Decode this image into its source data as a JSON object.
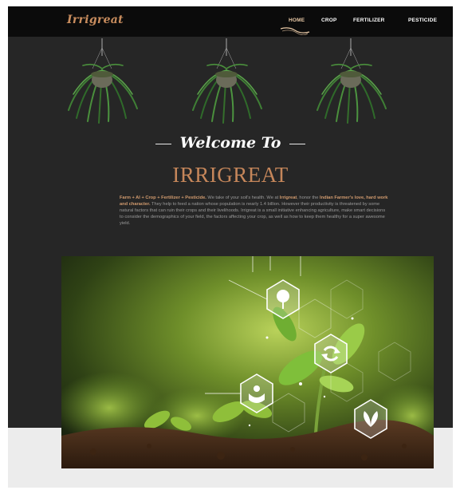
{
  "header": {
    "logo": "Irrigreat",
    "nav": [
      {
        "label": "HOME",
        "active": true
      },
      {
        "label": "CROP",
        "active": false
      },
      {
        "label": "FERTILIZER",
        "active": false
      },
      {
        "label": "PESTICIDE",
        "active": false
      }
    ]
  },
  "hero": {
    "welcome": "Welcome To",
    "brand": "IRRIGREAT"
  },
  "intro": {
    "highlight_1": "Farm + AI + Crop + Fertilizer + Pesticide.",
    "text_1": " We take of your soil's health. We at ",
    "highlight_2": "Irrigreat",
    "text_2": ", honor the ",
    "highlight_3": "Indian Farmer's love, hard work and character.",
    "text_3": " They help to feed a nation whose population is nearly 1.4 billion. However their productivity is threatened by some natural factors that can ruin their crops and their livelihoods. Irrigreat is a small initiative enhancing agriculture, make smart decisions to consider the demographics of your field, the factors affecting your crop, as well as how to keep them healthy for a super awesome yield."
  },
  "icons": {
    "plant_1": "hanging-plant-icon",
    "plant_2": "hanging-plant-icon",
    "plant_3": "hanging-plant-icon",
    "tree": "tree-icon",
    "recycle": "recycle-icon",
    "hands": "hands-icon",
    "leaf": "leaf-icon"
  },
  "colors": {
    "background": "#262626",
    "navbar": "#0b0b0b",
    "accent": "#c5865a",
    "nav_text": "#ffffff"
  }
}
